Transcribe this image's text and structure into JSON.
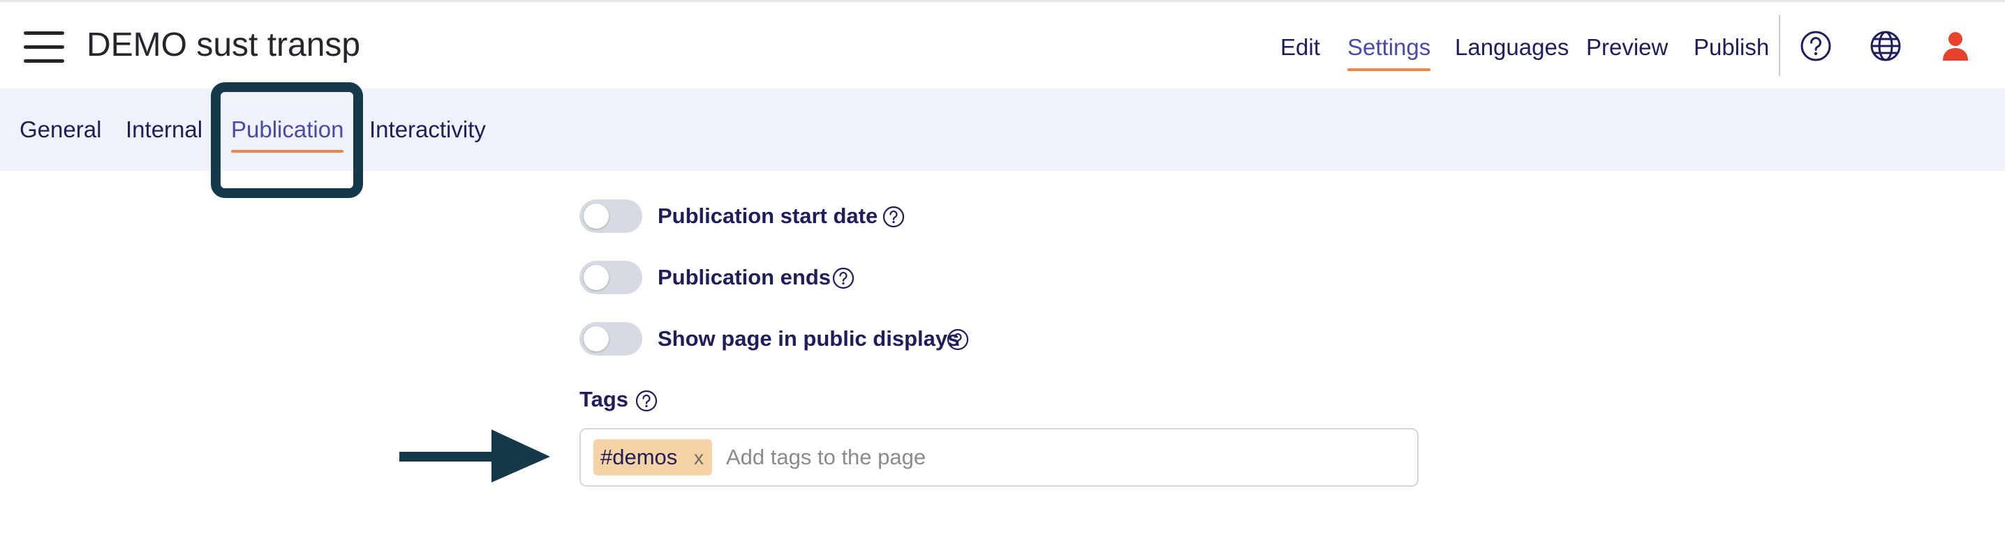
{
  "header": {
    "title": "DEMO sust transp",
    "nav": [
      {
        "label": "Edit"
      },
      {
        "label": "Settings",
        "active": true
      },
      {
        "label": "Languages"
      },
      {
        "label": "Preview"
      },
      {
        "label": "Publish"
      }
    ],
    "icons": [
      "help-circle-icon",
      "globe-icon",
      "user-icon"
    ]
  },
  "subtabs": [
    {
      "label": "General"
    },
    {
      "label": "Internal"
    },
    {
      "label": "Publication",
      "active": true
    },
    {
      "label": "Interactivity"
    }
  ],
  "toggles": [
    {
      "label": "Publication start date",
      "on": false
    },
    {
      "label": "Publication ends",
      "on": false
    },
    {
      "label": "Show page in public displays",
      "on": false
    }
  ],
  "tags": {
    "label": "Tags",
    "chips": [
      {
        "text": "#demos",
        "remove": "x"
      }
    ],
    "placeholder": "Add tags to the page"
  },
  "colors": {
    "text": "#1f1d5c",
    "accent": "#4a4aaa",
    "underline": "#e8864e",
    "subbar_bg": "#eff2f8",
    "chip_bg": "#f5d3a5",
    "annotation": "#15394b",
    "user_icon": "#e8412c"
  }
}
